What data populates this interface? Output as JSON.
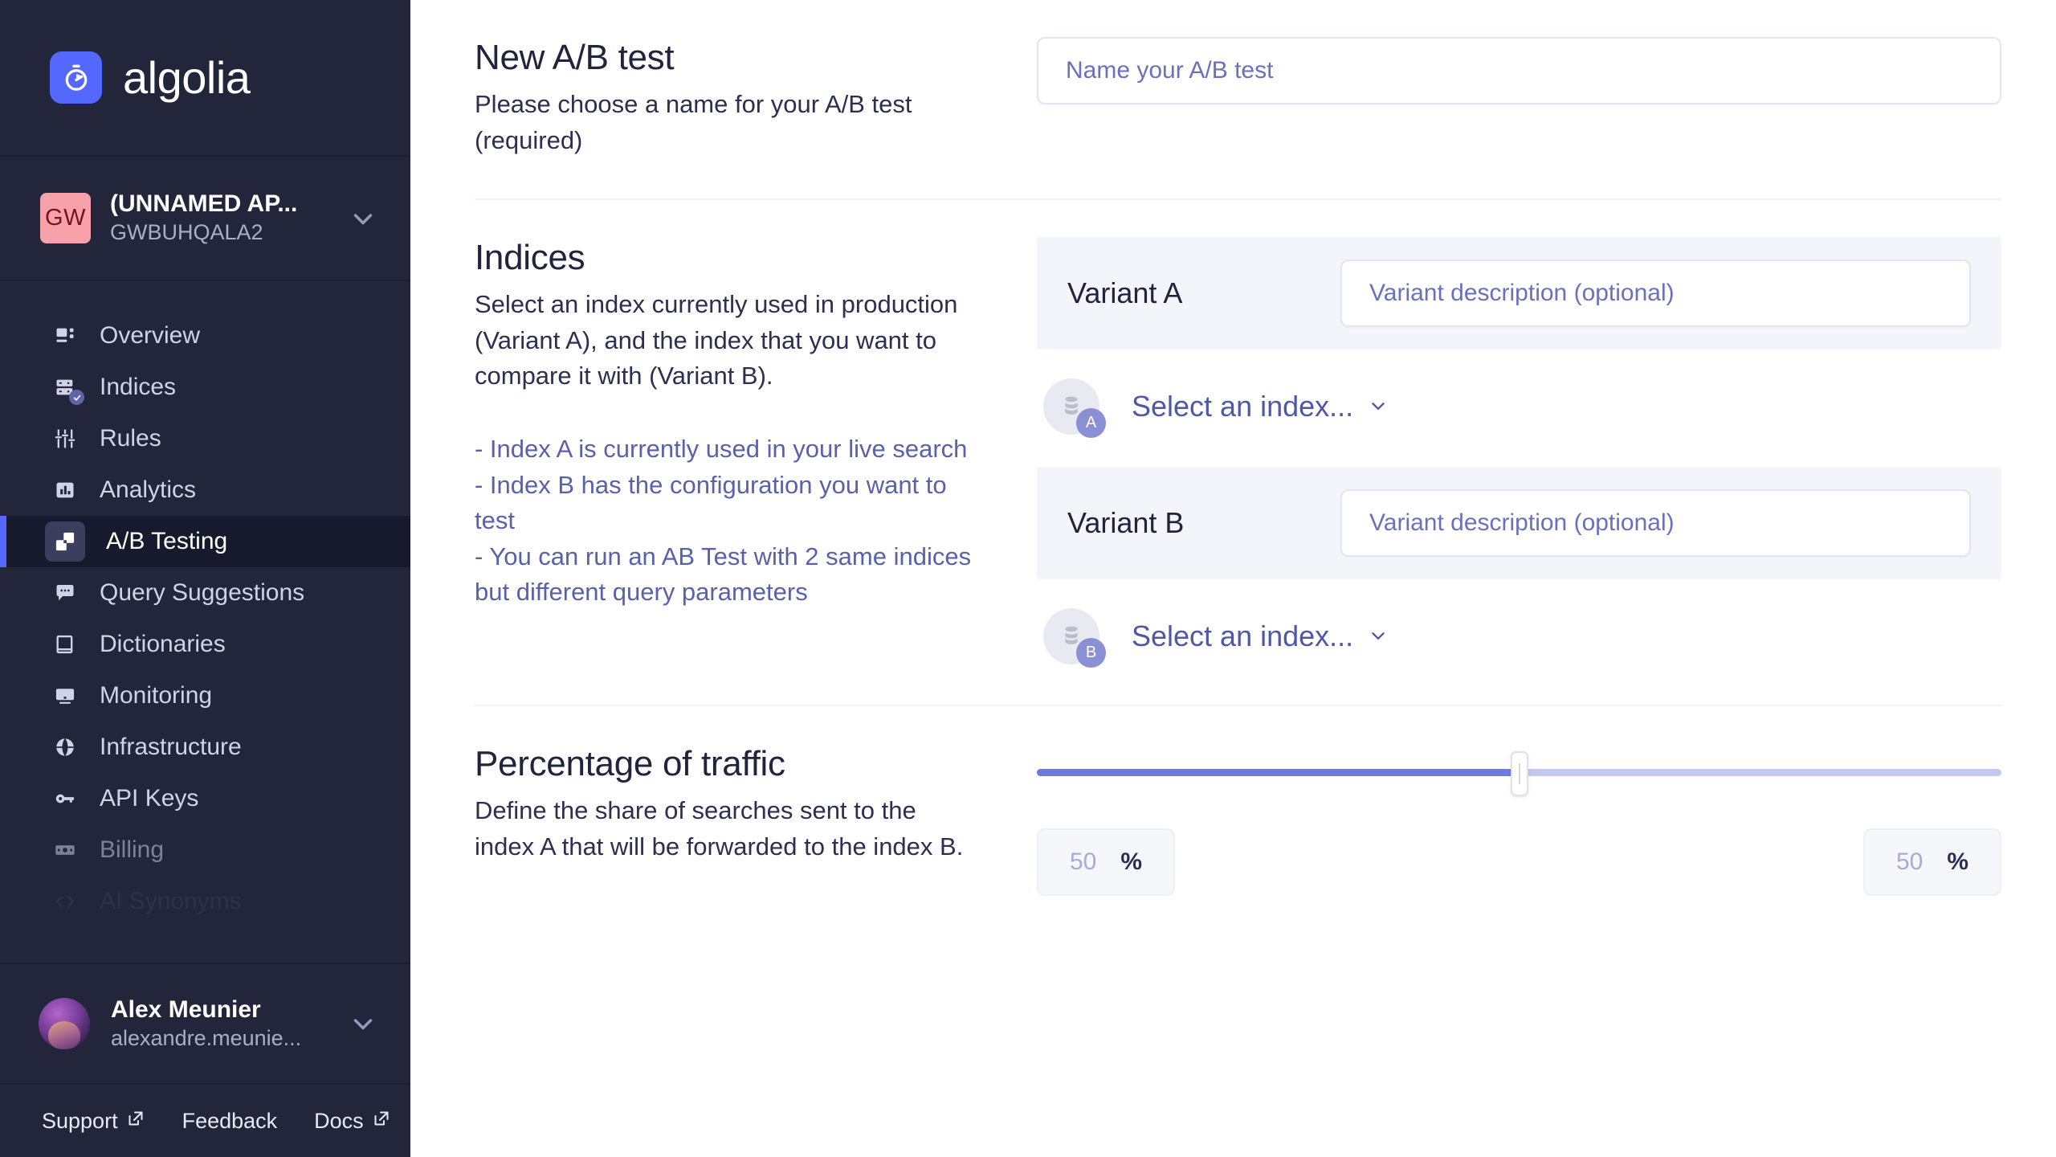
{
  "brand": {
    "name": "algolia",
    "logo_icon": "algolia-timer-icon",
    "accent": "#5468ff"
  },
  "sidebar": {
    "application": {
      "initials": "GW",
      "name": "(UNNAMED AP...",
      "id": "GWBUHQALA2",
      "chevron_icon": "chevron-down-icon"
    },
    "nav": [
      {
        "label": "Overview",
        "icon": "dashboard-icon",
        "active": false,
        "muted": false
      },
      {
        "label": "Indices",
        "icon": "database-check-icon",
        "active": false,
        "muted": false
      },
      {
        "label": "Rules",
        "icon": "sliders-icon",
        "active": false,
        "muted": false
      },
      {
        "label": "Analytics",
        "icon": "bar-chart-icon",
        "active": false,
        "muted": false
      },
      {
        "label": "A/B Testing",
        "icon": "ab-squares-icon",
        "active": true,
        "muted": false
      },
      {
        "label": "Query Suggestions",
        "icon": "chat-bubble-icon",
        "active": false,
        "muted": false
      },
      {
        "label": "Dictionaries",
        "icon": "book-icon",
        "active": false,
        "muted": false
      },
      {
        "label": "Monitoring",
        "icon": "monitor-icon",
        "active": false,
        "muted": false
      },
      {
        "label": "Infrastructure",
        "icon": "globe-icon",
        "active": false,
        "muted": false
      },
      {
        "label": "API Keys",
        "icon": "key-icon",
        "active": false,
        "muted": false
      },
      {
        "label": "Billing",
        "icon": "banknote-icon",
        "active": false,
        "muted": true
      },
      {
        "label": "AI Synonyms",
        "icon": "code-icon",
        "active": false,
        "muted": true
      }
    ],
    "user": {
      "name": "Alex Meunier",
      "email": "alexandre.meunie...",
      "chevron_icon": "chevron-down-icon"
    },
    "footer": [
      {
        "label": "Support",
        "icon": "external-link-icon"
      },
      {
        "label": "Feedback",
        "icon": ""
      },
      {
        "label": "Docs",
        "icon": "external-link-icon"
      }
    ]
  },
  "main": {
    "name_section": {
      "title": "New A/B test",
      "description": "Please choose a name for your A/B test (required)",
      "input_value": "",
      "input_placeholder": "Name your A/B test"
    },
    "indices_section": {
      "title": "Indices",
      "description": "Select an index currently used in production (Variant A), and the index that you want to compare it with (Variant B).",
      "hints": "- Index A is currently used in your live search\n- Index B has the configuration you want to test\n- You can run an AB Test with 2 same indices but different query parameters",
      "variants": [
        {
          "name": "Variant A",
          "badge": "A",
          "description_value": "",
          "description_placeholder": "Variant description (optional)",
          "index_select_label": "Select an index...",
          "index_icon": "database-stack-icon",
          "chevron_icon": "chevron-down-icon"
        },
        {
          "name": "Variant B",
          "badge": "B",
          "description_value": "",
          "description_placeholder": "Variant description (optional)",
          "index_select_label": "Select an index...",
          "index_icon": "database-stack-icon",
          "chevron_icon": "chevron-down-icon"
        }
      ]
    },
    "traffic_section": {
      "title": "Percentage of traffic",
      "description": "Define the share of searches sent to the index A that will be forwarded to the index B.",
      "slider_value": 50,
      "left_value": "50",
      "left_unit": "%",
      "right_value": "50",
      "right_unit": "%"
    }
  }
}
